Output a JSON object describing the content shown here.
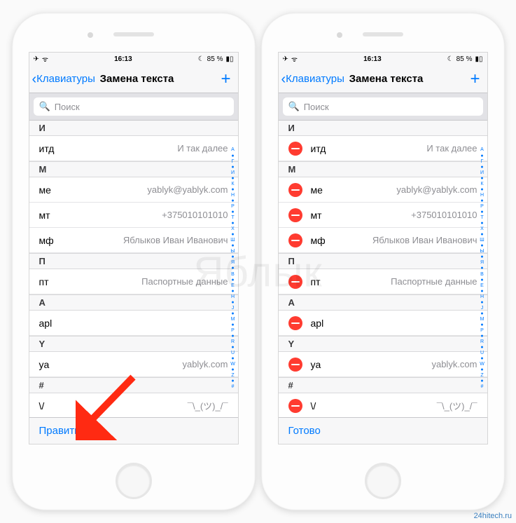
{
  "status": {
    "time": "16:13",
    "battery": "85 %",
    "airplane_glyph": "✈",
    "wifi_glyph": "ᯤ",
    "moon_glyph": "☾",
    "bat_glyph": "▮▯"
  },
  "nav": {
    "back_label": "Клавиатуры",
    "title": "Замена текста",
    "add_glyph": "+"
  },
  "search": {
    "placeholder": "Поиск",
    "mag_glyph": "🔍"
  },
  "sections": [
    {
      "letter": "И",
      "rows": [
        {
          "shortcut": "итд",
          "phrase": "И так далее"
        }
      ]
    },
    {
      "letter": "М",
      "rows": [
        {
          "shortcut": "ме",
          "phrase": "yablyk@yablyk.com"
        },
        {
          "shortcut": "мт",
          "phrase": "+375010101010"
        },
        {
          "shortcut": "мф",
          "phrase": "Яблыков Иван Иванович"
        }
      ]
    },
    {
      "letter": "П",
      "rows": [
        {
          "shortcut": "пт",
          "phrase": "Паспортные данные"
        }
      ]
    },
    {
      "letter": "A",
      "rows": [
        {
          "shortcut": "apl",
          "phrase": ""
        }
      ]
    },
    {
      "letter": "Y",
      "rows": [
        {
          "shortcut": "ya",
          "phrase": "yablyk.com"
        }
      ]
    },
    {
      "letter": "#",
      "rows": [
        {
          "shortcut": "\\/",
          "phrase": "¯\\_(ツ)_/¯"
        }
      ]
    }
  ],
  "index_letters": [
    "А",
    "●",
    "Г",
    "●",
    "И",
    "●",
    "К",
    "●",
    "Н",
    "●",
    "Р",
    "●",
    "Т",
    "●",
    "Х",
    "●",
    "Ш",
    "●",
    "Ы",
    "●",
    "Я",
    "●",
    "В",
    "●",
    "Е",
    "●",
    "Н",
    "●",
    "J",
    "●",
    "М",
    "●",
    "Р",
    "●",
    "R",
    "●",
    "U",
    "●",
    "W",
    "●",
    "Z",
    "●",
    "#"
  ],
  "toolbar": {
    "left_action_normal": "Править",
    "left_action_editing": "Готово"
  },
  "watermark": "Яблык",
  "credit": "24hitech.ru"
}
